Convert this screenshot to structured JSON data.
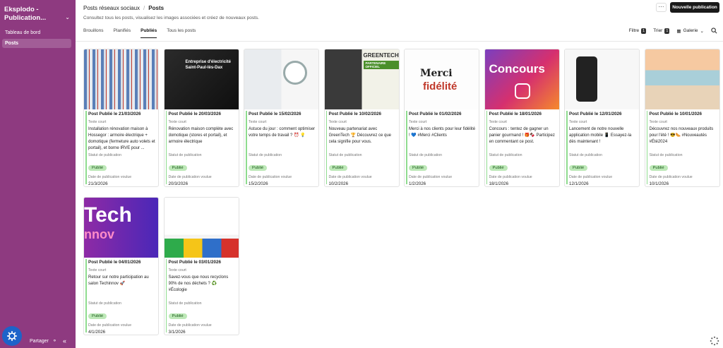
{
  "sidebar": {
    "workspace": "Eksplodo - Publication...",
    "nav": [
      {
        "label": "Tableau de bord",
        "active": false
      },
      {
        "label": "Posts",
        "active": true
      }
    ],
    "share": "Partager"
  },
  "header": {
    "breadcrumb_root": "Posts réseaux sociaux",
    "breadcrumb_current": "Posts",
    "subtitle": "Consultez tous les posts, visualisez les images associées et créez de nouveaux posts.",
    "more": "···",
    "new_button": "Nouvelle publication"
  },
  "tabs": [
    "Brouillons",
    "Planifiés",
    "Publiés",
    "Tous les posts"
  ],
  "active_tab": "Publiés",
  "toolbar": {
    "filter_label": "Filtre",
    "filter_count": "1",
    "sort_label": "Trier",
    "sort_count": "1",
    "view_label": "Galerie"
  },
  "field_labels": {
    "text": "Texte court",
    "status": "Statut de publication",
    "date": "Date de publication voulue"
  },
  "cards": [
    {
      "title": "Post Publié le 21/03/2026",
      "text": "Installation rénovation maison à Hossegor : armoire électrique + domotique (fermeture auto volets et portail), et borne IRVE pour ...",
      "status": "Publié",
      "date": "21/3/2026",
      "thumb": "panel"
    },
    {
      "title": "Post Publié le 20/03/2026",
      "text": "Rénovation maison complète avec domotique (stores et portail), et armoire électrique",
      "status": "Publié",
      "date": "20/3/2026",
      "thumb": "dark",
      "thumb_text": "Entreprise d'électricité Saint-Paul-lès-Dax"
    },
    {
      "title": "Post Publié le 15/02/2026",
      "text": "Astuce du jour : comment optimiser votre temps de travail ? ⏰ 💡",
      "status": "Publié",
      "date": "15/2/2026",
      "thumb": "clock"
    },
    {
      "title": "Post Publié le 10/02/2026",
      "text": "Nouveau partenariat avec GreenTech 🏆 Découvrez ce que cela signifie pour vous.",
      "status": "Publié",
      "date": "10/2/2026",
      "thumb": "greentech",
      "thumb_text": "GREENTECH",
      "thumb_sub": "PARTENAIRE OFFICIEL"
    },
    {
      "title": "Post Publié le 01/02/2026",
      "text": "Merci à nos clients pour leur fidélité ! 💙 #Merci #Clients",
      "status": "Publié",
      "date": "1/2/2026",
      "thumb": "merci",
      "thumb_text": "Merci",
      "thumb_sub": "fidélité"
    },
    {
      "title": "Post Publié le 18/01/2026",
      "text": "Concours : tentez de gagner un panier gourmand ! 🎁🍫 Participez en commentant ce post.",
      "status": "Publié",
      "date": "18/1/2026",
      "thumb": "concours",
      "thumb_text": "Concours"
    },
    {
      "title": "Post Publié le 12/01/2026",
      "text": "Lancement de notre nouvelle application mobile 📱 Essayez-la dès maintenant !",
      "status": "Publié",
      "date": "12/1/2026",
      "thumb": "phone"
    },
    {
      "title": "Post Publié le 10/01/2026",
      "text": "Découvrez nos nouveaux produits pour l'été ! 😎🌭 #Nouveautés #Été2024",
      "status": "Publié",
      "date": "10/1/2026",
      "thumb": "beach"
    },
    {
      "title": "Post Publié le 04/01/2026",
      "text": "Retour sur notre participation au salon Techinnov 🚀",
      "status": "Publié",
      "date": "4/1/2026",
      "thumb": "tech",
      "thumb_text": "Tech",
      "thumb_sub": "nnov"
    },
    {
      "title": "Post Publié le 03/01/2026",
      "text": "Savez-vous que nous recyclons 90% de nos déchets ? ♻️ #Écologie",
      "status": "Publié",
      "date": "3/1/2026",
      "thumb": "recycle"
    }
  ]
}
